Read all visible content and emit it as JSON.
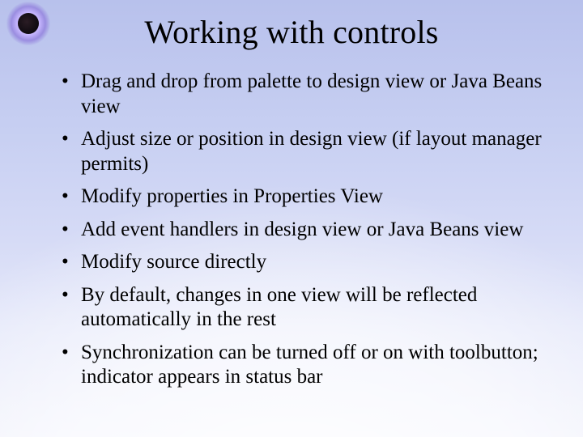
{
  "title": "Working with controls",
  "bullets": [
    "Drag and drop from palette to design view or Java Beans view",
    "Adjust size or position in design view (if layout manager permits)",
    "Modify properties in Properties View",
    "Add event handlers in design view or Java Beans view",
    "Modify source directly",
    "By default, changes in one view will be reflected automatically in the rest",
    "Synchronization can be turned off or on with toolbutton; indicator appears in status bar"
  ]
}
